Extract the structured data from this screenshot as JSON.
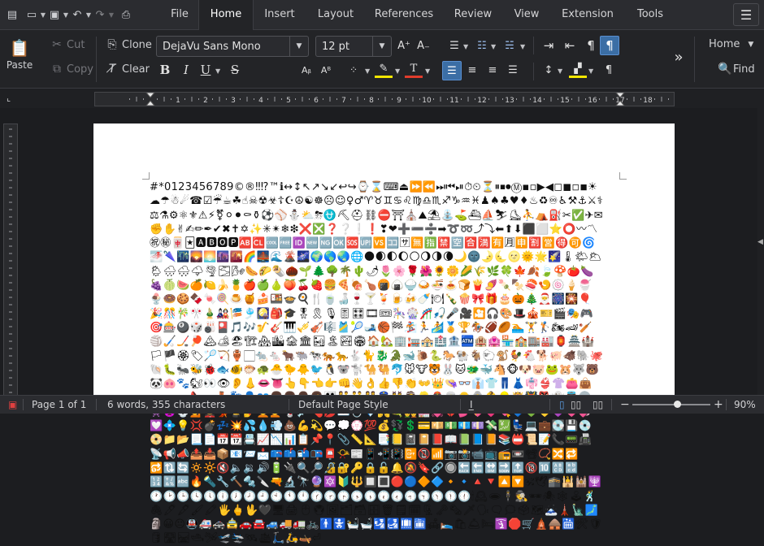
{
  "tabs": [
    "File",
    "Home",
    "Insert",
    "Layout",
    "References",
    "Review",
    "View",
    "Extension",
    "Tools"
  ],
  "active_tab": "Home",
  "clipboard": {
    "paste": "Paste",
    "cut": "Cut",
    "copy": "Copy",
    "clone": "Clone",
    "clear": "Clear"
  },
  "font": {
    "name": "DejaVu Sans Mono",
    "size": "12 pt"
  },
  "style_box": {
    "label": "Home",
    "find": "Find"
  },
  "ruler": {
    "labels": [
      "1",
      "2",
      "3",
      "4",
      "5",
      "6",
      "7",
      "8",
      "9",
      "10",
      "11",
      "12",
      "13",
      "14",
      "15",
      "16",
      "17",
      "18"
    ]
  },
  "document": {
    "text": "#*0123456789©®‼⁉™ℹ↔↕↖↗↘↙↩↪⌚⌛⌨⏏⏩⏪⏭⏮⏯⏱⏲⏳⏸⏹⏺Ⓜ▪▫▶◀◻◼◽◾☀☁☂☃☄☎☑☔☕☘☝☠☢☣☦☪☮☯☸☹☺♀♂♈♉♊♋♌♍♎♏♐♑♒♓♟♠♣♥♦♨♻♾♿⚒⚓⚔⚕⚖⚗⚙⚛⚜⚠⚡⚧⚪⚫⚰⚱⚽⚾⛄⛅⛈⛎⛏⛑⛓⛔⛩⛪⛰⛱⛲⛳⛴⛵⛷⛸⛹⛺⛽✂✅✈✉✊✋✌✍✏✒✔✖✝✡✨✳✴❄❇❌❎❓❔❕❗❣❤➕➖➗➡➰➿⤴⤵⬅⬆⬇⬛⬜⭐⭕〰〽㊗㊙🀄🃏🅰🅱🅾🅿🆎🆑🆒🆓🆔🆕🆖🆗🆘🆙🆚🈁🈂🈚🈯🈲🈳🈴🈵🈶🈷🈸🈹🈺🉐🉑🌀🌁🌂🌃🌄🌅🌆🌇🌈🌉🌊🌋🌌🌍🌎🌏🌐🌑🌒🌓🌔🌕🌖🌗🌘🌙🌚🌛🌜🌝🌞🌟🌠🌡🌤🌥🌦🌧🌨🌩🌪🌫🌬🌭🌮🌯🌰🌱🌲🌳🌴🌵🌶🌷🌸🌹🌺🌻🌼🌽🌾🌿🍀🍁🍂🍃🍄🍅🍆🍇🍈🍉🍊🍋🍌🍍🍎🍏🍐🍑🍒🍓🍔🍕🍖🍗🍘🍙🍚🍛🍜🍝🍞🍟🍠🍡🍢🍣🍤🍥🍦🍧🍨🍩🍪🍫🍬🍭🍮🍯🍰🍱🍲🍳🍴🍵🍶🍷🍸🍹🍺🍻🍼🍽🍾🍿🎀🎁🎂🎃🎄🎅🎆🎇🎈🎉🎊🎋🎌🎍🎎🎏🎐🎑🎒🎓🎖🎗🎙🎚🎛🎞🎟🎠🎡🎢🎣🎤🎥🎦🎧🎨🎩🎪🎫🎬🎭🎮🎯🎰🎱🎲🎳🎴🎵🎶🎷🎸🎹🎺🎻🎼🎽🎾🎿🏀🏁🏂🏃🏄🏅🏆🏇🏈🏉🏊🏋🏌🏍🏎🏏🏐🏑🏒🏓🏔🏕🏖🏗🏘🏙🏚🏛🏜🏝🏞🏟🏠🏡🏢🏣🏤🏥🏦🏧🏨🏩🏪🏫🏬🏭🏮🏯🏰🏳🏴🏵🏷🏸🏹🏺🏻🐀🐁🐂🐃🐄🐅🐆🐇🐈🐉🐊🐋🐌🐍🐎🐏🐐🐑🐒🐓🐔🐕🐖🐗🐘🐙🐚🐛🐜🐝🐞🐟🐠🐡🐢🐣🐤🐥🐦🐧🐨🐩🐪🐫🐬🐭🐮🐯🐰🐱🐲🐳🐴🐵🐶🐷🐸🐹🐺🐻🐼🐽🐾🐿👀👁👂👃👄👅👆👇👈👉👊👋👌👍👎👏👐👑👒👓👔👕👖👗👘👙👚👛👜👝👞👟👠👡👢👣👤👥👦👧👨👩👪👫👬👭👮👯👰👱👲👳👴👵👶👷👸👹👺👻👼👽👾👿💀💁💂💃💄💅💆💇💈💉💊💋💌💍💎💏💐💑💒💓💔💕💖💗💘💙💚💛💜💝💞💟💠💡💢💣💤💥💦💧💨💩💪💫💬💭💮💯💰💱💲💳💴💵💶💷💸💹💺💻💼💽💾💿📀📁📂📃📄📅📆📇📈📉📊📋📌📍📎📏📐📑📒📓📔📕📖📗📘📙📚📛📜📝📞📟📠📡📢📣📤📥📦📧📨📩📪📫📬📭📮📯📰📱📲📳📴📵📶📷📸📹📺📻📼📽📿🔀🔁🔂🔃🔄🔅🔆🔇🔈🔉🔊🔋🔌🔍🔎🔏🔐🔑🔒🔓🔔🔕🔖🔗🔘🔙🔚🔛🔜🔝🔞🔟🔠🔡🔢🔣🔤🔥🔦🔧🔨🔩🔪🔫🔬🔭🔮🔯🔰🔱🔲🔳🔴🔵🔶🔷🔸🔹🔺🔻🔼🔽🕉🕊🕋🕌🕍🕎🕐🕑🕒🕓🕔🕕🕖🕗🕘🕙🕚🕛🕜🕝🕞🕟🕠🕡🕢🕣🕤🕥🕦🕧🕯🕰🕳🕴🕵🕶🕷🕸🕹🕺🖇🖊🖋🖌🖍🖐🖕🖖🖤🖥🖨🖱🖲🖼🗂🗃🗄🗑🗒🗓🗜🗝🗞🗡🗣🗨🗯🗳🗺🗻🗼🗽🗾🗿😀😐🚇🚑🚓🚖🚗🚘🚙🚚🚛🚲🚹🚼🛀🛁🛂🛃🛄🛅🛋🛌🛍🛎🛏🛐🛑🛒🛕🛖🛗🛠🛡🛢🛣🛤🛥🛩🛫🛬🛰🛳🛴🛵🛶⏎"
  },
  "status": {
    "page": "Page 1 of 1",
    "words": "6 words, 355 characters",
    "style": "Default Page Style",
    "zoom": "90%",
    "zoom_level": 0.57
  },
  "icons": [
    "app-menu-icon",
    "open-icon",
    "save-icon",
    "undo-icon",
    "redo-icon",
    "print-icon",
    "paste-icon",
    "cut-icon",
    "copy-icon",
    "clone-icon",
    "clear-icon",
    "bold-icon",
    "italic-icon",
    "underline-icon",
    "strikethrough-icon",
    "align-left-icon",
    "align-center-icon",
    "align-right-icon",
    "justify-icon",
    "pilcrow-icon",
    "hamburger-icon",
    "search-icon"
  ]
}
